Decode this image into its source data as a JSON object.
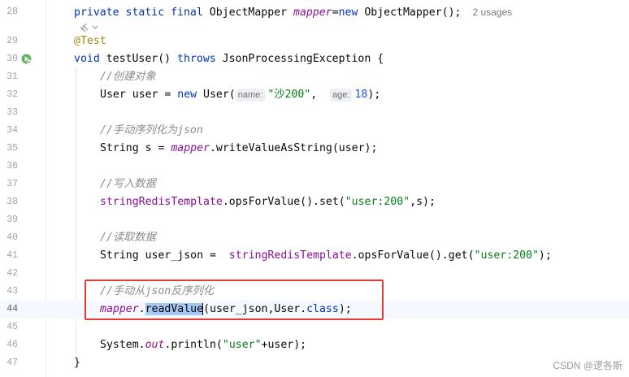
{
  "editor": {
    "line_numbers": [
      "28",
      "29",
      "30",
      "31",
      "32",
      "33",
      "34",
      "35",
      "36",
      "37",
      "38",
      "39",
      "40",
      "41",
      "42",
      "43",
      "44",
      "45",
      "46",
      "47"
    ],
    "line28": {
      "kw1": "private static final",
      "type": "ObjectMapper",
      "field": "mapper",
      "eq": "=",
      "kw_new": "new",
      "ctor": "ObjectMapper();",
      "usages": "2 usages"
    },
    "line29": {
      "annotation": "@Test"
    },
    "line30": {
      "kw_void": "void",
      "method": "testUser()",
      "kw_throws": "throws",
      "exception": "JsonProcessingException {"
    },
    "line31": {
      "comment": "//创建对象"
    },
    "line32": {
      "pre": "User user = ",
      "kw_new": "new",
      "ctor_open": " User(",
      "hint_name": "name:",
      "str_name": "\"沙200\"",
      "comma": ",",
      "hint_age": "age:",
      "num_age": "18",
      "close": ");"
    },
    "line34": {
      "comment": "//手动序列化为json"
    },
    "line35": {
      "pre": "String s = ",
      "field": "mapper",
      "post": ".writeValueAsString(user);"
    },
    "line37": {
      "comment": "//写入数据"
    },
    "line38": {
      "field": "stringRedisTemplate",
      "mid": ".opsForValue().set(",
      "str": "\"user:200\"",
      "post": ",s);"
    },
    "line40": {
      "comment": "//读取数据"
    },
    "line41": {
      "pre": "String user_json =  ",
      "field": "stringRedisTemplate",
      "mid": ".opsForValue().get(",
      "str": "\"user:200\"",
      "post": ");"
    },
    "line43": {
      "comment": "//手动从json反序列化"
    },
    "line44": {
      "field": "mapper",
      "dot": ".",
      "selected": "readValue",
      "args_open": "(user_json,User.",
      "kw_class": "class",
      "close": ");"
    },
    "line46": {
      "pre": "System.",
      "field": "out",
      "mid": ".println(",
      "str": "\"user\"",
      "post": "+user);"
    },
    "line47": {
      "brace": "}"
    }
  },
  "watermark": "CSDN @逻各斯",
  "colors": {
    "keyword": "#0033b3",
    "field": "#871094",
    "string": "#067d17",
    "number": "#1750eb",
    "comment": "#8c8c8c",
    "highlight_box": "#e53935"
  },
  "icons": [
    "run-test-icon",
    "intention-bulb-icon"
  ]
}
